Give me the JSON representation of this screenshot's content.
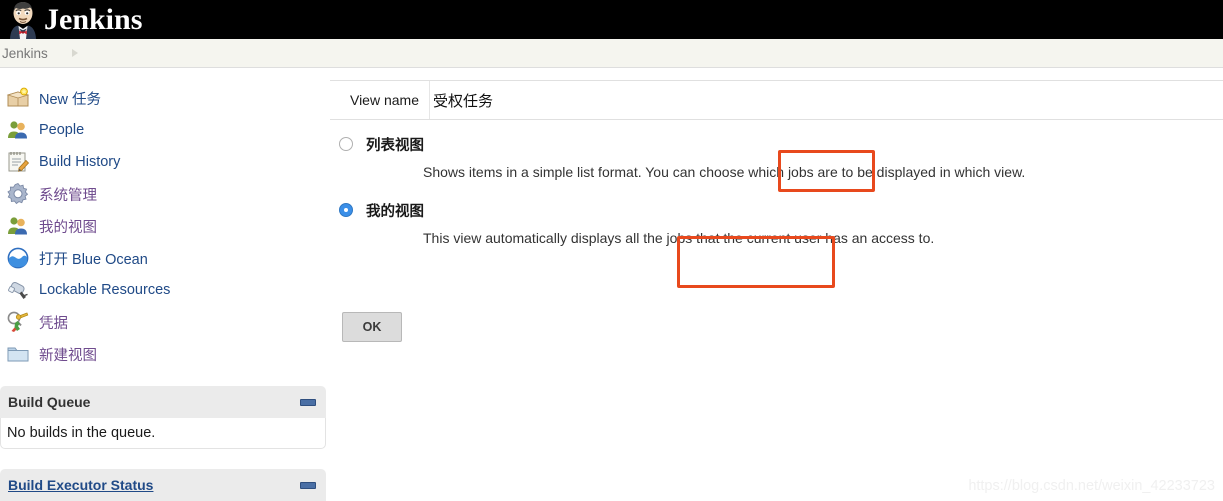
{
  "header": {
    "brand": "Jenkins",
    "logo_icon": "jenkins-butler-icon"
  },
  "breadcrumb": {
    "root": "Jenkins",
    "separator_icon": "chevron-right-icon"
  },
  "sidebar": {
    "items": [
      {
        "label": "New 任务",
        "icon": "new-item-box-icon",
        "visited": false
      },
      {
        "label": "People",
        "icon": "people-icon",
        "visited": false
      },
      {
        "label": "Build History",
        "icon": "build-history-notepad-icon",
        "visited": false
      },
      {
        "label": "系统管理",
        "icon": "gear-icon",
        "visited": true
      },
      {
        "label": "我的视图",
        "icon": "my-views-people-icon",
        "visited": true
      },
      {
        "label": "打开 Blue Ocean",
        "icon": "blue-ocean-icon",
        "visited": false
      },
      {
        "label": "Lockable Resources",
        "icon": "lockable-resources-icon",
        "visited": false
      },
      {
        "label": "凭据",
        "icon": "credentials-key-icon",
        "visited": true
      },
      {
        "label": "新建视图",
        "icon": "folder-icon",
        "visited": true
      }
    ],
    "build_queue": {
      "title": "Build Queue",
      "empty_text": "No builds in the queue.",
      "collapse_icon": "collapse-icon"
    },
    "build_executor": {
      "title": "Build Executor Status",
      "collapse_icon": "collapse-icon"
    }
  },
  "main": {
    "view_name": {
      "label": "View name",
      "value": "受权任务",
      "placeholder": ""
    },
    "view_types": [
      {
        "label": "列表视图",
        "description": "Shows items in a simple list format. You can choose which jobs are to be displayed in which view.",
        "selected": false
      },
      {
        "label": "我的视图",
        "description": "This view automatically displays all the jobs that the current user has an access to.",
        "selected": true
      }
    ],
    "ok_button": "OK"
  },
  "watermark": "https://blog.csdn.net/weixin_42233723",
  "colors": {
    "header_bg": "#000000",
    "breadcrumb_bg": "#f5f5ef",
    "link": "#204a87",
    "visited_link": "#6f4b8e",
    "annotation": "#e8491d",
    "radio_selected": "#3b8fe8"
  }
}
